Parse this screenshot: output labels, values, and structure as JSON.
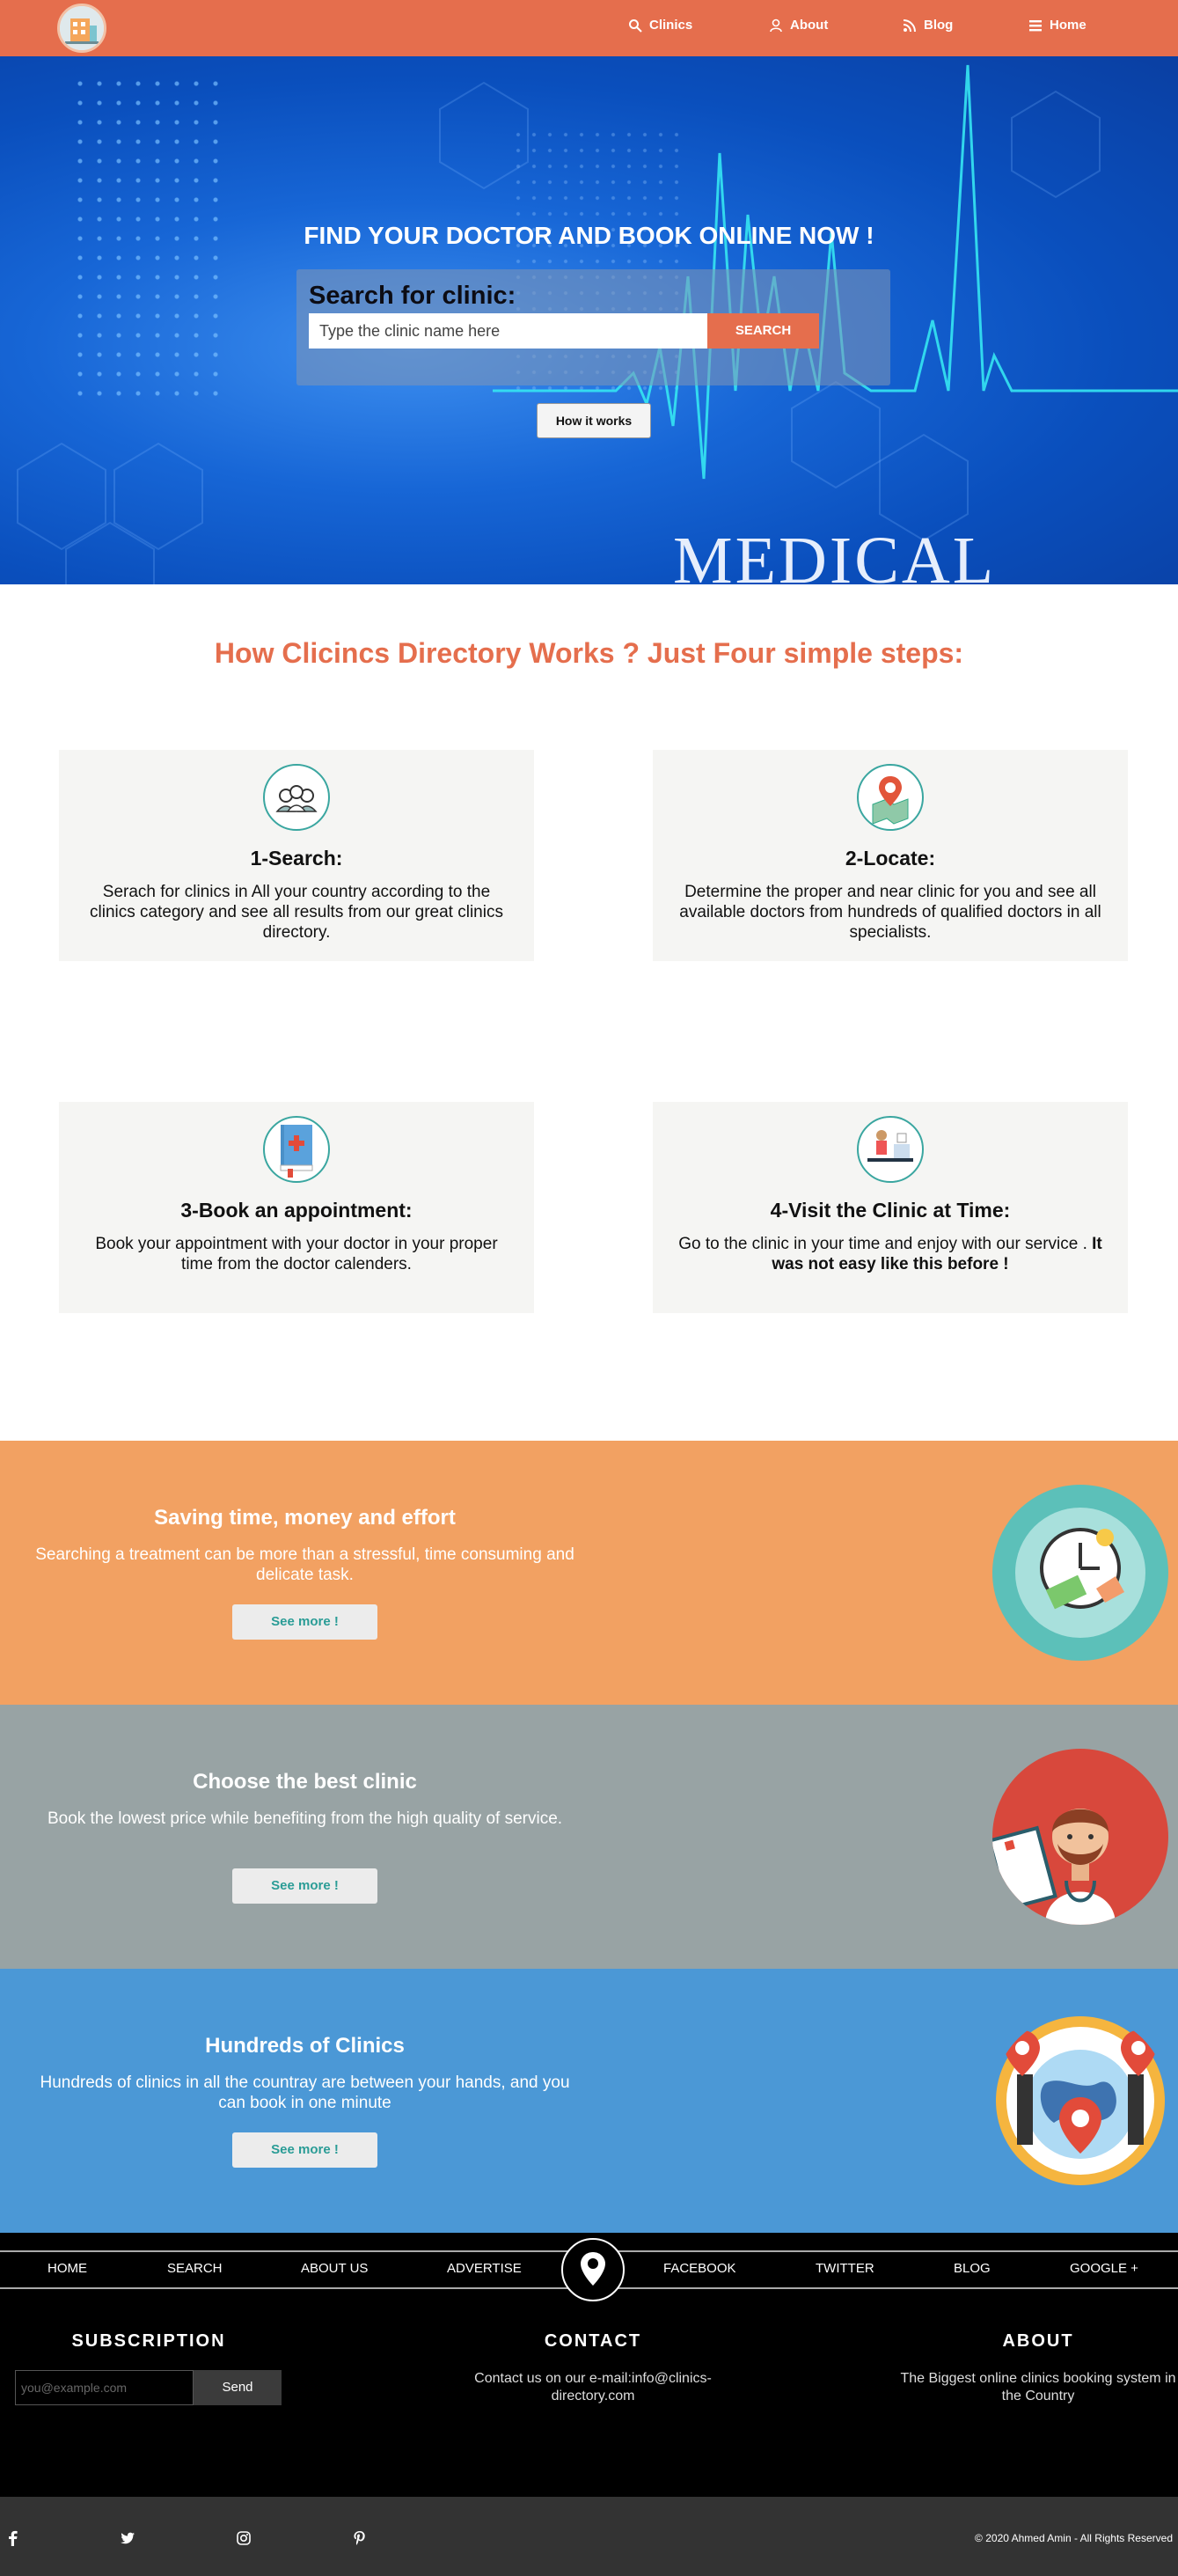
{
  "nav": {
    "clinics": "Clinics",
    "about": "About",
    "blog": "Blog",
    "home": "Home"
  },
  "hero": {
    "title": "FIND YOUR DOCTOR AND BOOK ONLINE NOW !",
    "search_label": "Search for clinic:",
    "search_placeholder": "Type the clinic name here",
    "search_button": "SEARCH",
    "how_button": "How it works",
    "background_text": "MEDICAL"
  },
  "steps": {
    "title": "How Clicincs Directory Works ? Just Four simple steps:",
    "items": [
      {
        "title": "1-Search:",
        "text": "Serach for clinics in All your country according to the clinics category and see all results from our great clinics directory.",
        "bold": ""
      },
      {
        "title": "2-Locate:",
        "text": "Determine the proper and near clinic for you and see all available doctors from hundreds of qualified doctors in all specialists.",
        "bold": ""
      },
      {
        "title": "3-Book an appointment:",
        "text": "Book your appointment with your doctor in your proper time from the doctor calenders.",
        "bold": ""
      },
      {
        "title": "4-Visit the Clinic at Time:",
        "text": "Go to the clinic in your time and enjoy with our service .",
        "bold": "It was not easy like this before !"
      }
    ]
  },
  "bands": [
    {
      "title": "Saving time, money and effort",
      "text": "Searching a treatment can be more than a stressful, time consuming and delicate task.",
      "button": "See more !",
      "color": "#f2a162"
    },
    {
      "title": "Choose the best clinic",
      "text": "Book the lowest price while benefiting from the high quality of service.",
      "button": "See more !",
      "color": "#98a3a4"
    },
    {
      "title": "Hundreds of Clinics",
      "text": "Hundreds of clinics in all the countray are between your hands, and you can book in one minute",
      "button": "See more !",
      "color": "#4b98d6"
    }
  ],
  "footer": {
    "nav": [
      "HOME",
      "SEARCH",
      "ABOUT US",
      "ADVERTISE",
      "FACEBOOK",
      "TWITTER",
      "BLOG",
      "GOOGLE +"
    ],
    "subscription_title": "SUBSCRIPTION",
    "subscription_placeholder": "you@example.com",
    "send_button": "Send",
    "contact_title": "CONTACT",
    "contact_text": "Contact us on our e-mail:info@clinics-directory.com",
    "about_title": "ABOUT",
    "about_text": "The Biggest online clinics booking system in the Country",
    "copyright": "© 2020 Ahmed Amin - All Rights Reserved",
    "social_icons": [
      "facebook-icon",
      "twitter-icon",
      "instagram-icon",
      "pinterest-icon"
    ]
  },
  "colors": {
    "accent": "#e56e4d",
    "band_orange": "#f2a162",
    "band_gray": "#98a3a4",
    "band_blue": "#4b98d6",
    "teal": "#2a9c96"
  }
}
